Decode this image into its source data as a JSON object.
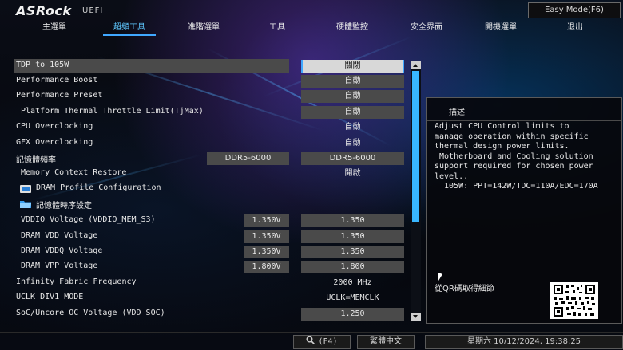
{
  "brand": {
    "logo": "ASRock",
    "sub": "UEFI"
  },
  "mode_button": "Easy Mode(F6)",
  "tabs": [
    "主選單",
    "超頻工具",
    "進階選單",
    "工具",
    "硬體監控",
    "安全界面",
    "開機選單",
    "退出"
  ],
  "active_tab": 1,
  "rows": [
    {
      "label": "TDP to 105W",
      "value": "關閉"
    },
    {
      "label": "Performance Boost",
      "value": "自動"
    },
    {
      "label": "Performance Preset",
      "value": "自動"
    },
    {
      "label": "Platform Thermal Throttle Limit(TjMax)",
      "value": "自動"
    },
    {
      "label": "CPU Overclocking",
      "value": "自動"
    },
    {
      "label": "GFX Overclocking",
      "value": "自動"
    },
    {
      "label": "記憶體頻率",
      "current": "DDR5-6000",
      "value": "DDR5-6000"
    },
    {
      "label": "Memory Context Restore",
      "value": "開啟"
    },
    {
      "label": "DRAM Profile Configuration"
    },
    {
      "label": "記憶體時序設定"
    },
    {
      "label": "VDDIO Voltage (VDDIO_MEM_S3)",
      "current": "1.350V",
      "value": "1.350"
    },
    {
      "label": "DRAM VDD Voltage",
      "current": "1.350V",
      "value": "1.350"
    },
    {
      "label": "DRAM VDDQ Voltage",
      "current": "1.350V",
      "value": "1.350"
    },
    {
      "label": "DRAM VPP Voltage",
      "current": "1.800V",
      "value": "1.800"
    },
    {
      "label": "Infinity Fabric Frequency",
      "value": "2000 MHz"
    },
    {
      "label": "UCLK DIV1 MODE",
      "value": "UCLK=MEMCLK"
    },
    {
      "label": "SoC/Uncore OC Voltage (VDD_SOC)",
      "value": "1.250"
    }
  ],
  "description": {
    "title": "描述",
    "text": "Adjust CPU Control limits to\nmanage operation within specific\nthermal design power limits.\n Motherboard and Cooling solution\nsupport required for chosen power\nlevel..\n  105W: PPT=142W/TDC=110A/EDC=170A",
    "qr_label": "從QR碼取得細節"
  },
  "footer": {
    "search": "(F4)",
    "language": "繁體中文",
    "datetime": "星期六 10/12/2024, 19:38:25"
  },
  "colors": {
    "accent": "#40a8ff",
    "scroll_thumb": "#38b6ff",
    "value_box": "#4a4a4a",
    "selected_value": "#d8d8d8"
  },
  "icons": {
    "search": "magnifier-icon",
    "folder": "folder-icon"
  }
}
